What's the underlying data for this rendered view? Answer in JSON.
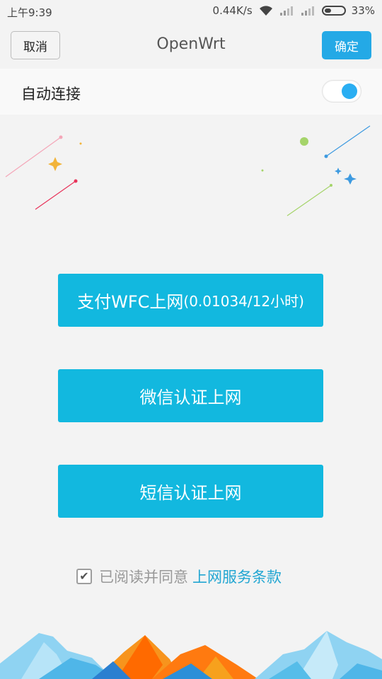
{
  "status_bar": {
    "time": "上午9:39",
    "speed": "0.44K/s",
    "battery_pct": "33%"
  },
  "header": {
    "cancel_label": "取消",
    "title": "OpenWrt",
    "ok_label": "确定"
  },
  "auto_connect": {
    "label": "自动连接",
    "enabled": true
  },
  "buttons": {
    "wfc_label": "支付WFC上网",
    "wfc_price": "(0.01034/12小时)",
    "wechat_label": "微信认证上网",
    "sms_label": "短信认证上网"
  },
  "agreement": {
    "checked": true,
    "text": "已阅读并同意",
    "link_text": "上网服务条款"
  },
  "colors": {
    "accent": "#24a9e6",
    "button": "#12b8df",
    "link": "#22a6d2"
  }
}
